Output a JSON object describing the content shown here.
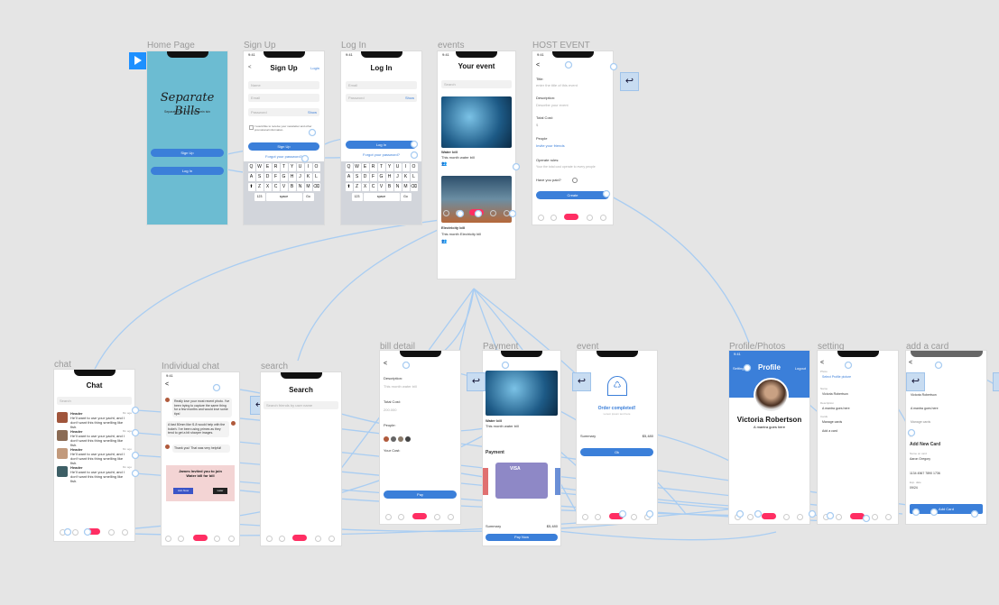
{
  "colors": {
    "canvas": "#e5e5e5",
    "teal": "#6cbcd2",
    "accent_blue": "#3b7fd9",
    "pink": "#ff2e63",
    "connector": "#a9cdf2"
  },
  "play_icon": "play-icon",
  "frame_labels": {
    "home": "Home Page",
    "signup": "Sign Up",
    "login": "Log In",
    "events": "events",
    "host": "HOST EVENT",
    "chat": "chat",
    "ichat": "Individual chat",
    "search": "search",
    "bill": "bill detail",
    "payment": "Payment",
    "event2": "event",
    "profile": "Profile/Photos",
    "setting": "setting",
    "card": "add a card"
  },
  "status_time": "9:41",
  "home": {
    "app_name": "Separate Bills",
    "tagline": "Separated by Ferd Eleinarrin isin",
    "signup_btn": "Sign Up",
    "login_btn": "Log In"
  },
  "signup": {
    "title": "Sign Up",
    "login_link": "Login",
    "name_ph": "Name",
    "email_ph": "Email",
    "password_ph": "Password",
    "show": "Show",
    "consent": "I would like to receive your newsletter and other promotional information.",
    "btn": "Sign Up",
    "forgot": "Forgot your password?"
  },
  "login": {
    "title": "Log In",
    "email_ph": "Email",
    "password_ph": "Password",
    "show": "Show",
    "btn": "Log In",
    "forgot": "Forgot your password?"
  },
  "keyboard": {
    "row1": [
      "Q",
      "W",
      "E",
      "R",
      "T",
      "Y",
      "U",
      "I",
      "O",
      "P"
    ],
    "row2": [
      "A",
      "S",
      "D",
      "F",
      "G",
      "H",
      "J",
      "K",
      "L"
    ],
    "row3": [
      "Z",
      "X",
      "C",
      "V",
      "B",
      "N",
      "M"
    ],
    "space": "space",
    "go": "Go",
    "num": "123"
  },
  "events": {
    "title": "Your event",
    "search_ph": "Search",
    "item1_title": "Water bill",
    "item1_desc": "This month water bill",
    "item2_title": "Electricity bill",
    "item2_desc": "This month Electricity bill"
  },
  "host": {
    "title_label": "Title:",
    "title_ph": "enter the title of this event",
    "desc_label": "Description:",
    "desc_ph": "Describe your event",
    "total_label": "Total Cost:",
    "total_ph": "$",
    "people_label": "People",
    "invite": "Invite your friends",
    "rules_label": "Operate rules:",
    "rules_ph": "Your the total cost operate to every people",
    "paid_label": "Have you paid?",
    "create_btn": "Create"
  },
  "chat": {
    "title": "Chat",
    "search_ph": "Search",
    "rows": [
      {
        "name": "Header",
        "text": "He'll want to use your yacht, and I don't want this thing smelling like fish.",
        "time": "8m ago"
      },
      {
        "name": "Header",
        "text": "He'll want to use your yacht, and I don't want this thing smelling like fish.",
        "time": "8m ago"
      },
      {
        "name": "Header",
        "text": "He'll want to use your yacht, and I don't want this thing smelling like fish.",
        "time": "8m ago"
      },
      {
        "name": "Header",
        "text": "He'll want to use your yacht, and I don't want this thing smelling like fish.",
        "time": "8m ago"
      }
    ]
  },
  "ichat": {
    "msg1": "Really love your most recent photo. I've been trying to capture the same thing for a few months and would love some tips!",
    "msg2": "A fast 50mm like f1.8 would help with the bokeh. I've been using primes as they tend to get a bit sharper images.",
    "msg3": "Thank you! That was very helpful!",
    "card_text": "James Invited you to join Water bill for bill",
    "join": "Join Now",
    "later": "Later"
  },
  "search": {
    "title": "Search",
    "search_ph": "Search friends by user name"
  },
  "bill": {
    "desc_label": "Description:",
    "desc_ph": "This month water bill",
    "total_label": "Total Cost:",
    "total_ph": "200.000",
    "people_label": "People:",
    "your_label": "Your Cost:",
    "pay_btn": "Pay"
  },
  "payment": {
    "item_title": "Water bill",
    "item_desc": "This month water bill",
    "section": "Payment",
    "card_brand": "VISA",
    "summary": "Summary",
    "amount": "$5,480",
    "paynow": "Pay Now"
  },
  "event2": {
    "heading": "Order completed!",
    "sub": "Lorem ipsum text here",
    "summary": "Summary",
    "amount": "$5,480",
    "ok": "Ok"
  },
  "profile": {
    "settings": "Settings",
    "title": "Profile",
    "logout": "Logout",
    "name": "Victoria Robertson",
    "subtitle": "A mantra goes here"
  },
  "setting": {
    "photo_label": "Photo",
    "photo_link": "Select Profile picture",
    "name_label": "Name",
    "name_value": "Victoria Robertson",
    "bio_label": "Description",
    "bio_value": "A mantra goes here",
    "cards_label": "Cards",
    "manage": "Manage cards",
    "add_card": "Add a card"
  },
  "card": {
    "name_label": "Name",
    "name_value": "Victoria Robertson",
    "bio_value": "A mantra goes here",
    "manage": "Manage cards",
    "heading": "Add New Card",
    "holder_label": "Name on card",
    "holder_value": "Aaron Gregory",
    "number_value": "1134 4567 7890 1736",
    "exp_label": "Exp. date",
    "exp_value": "09/24",
    "btn": "Add Card"
  }
}
